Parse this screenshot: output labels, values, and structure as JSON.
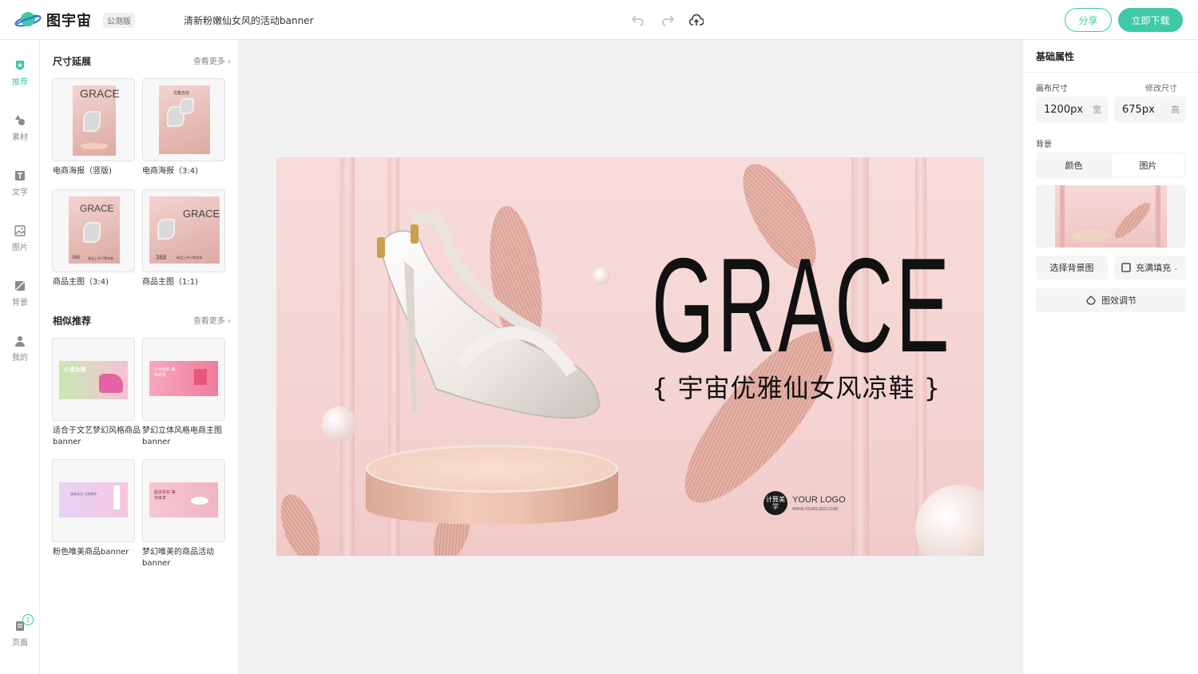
{
  "header": {
    "brand": "图宇宙",
    "beta": "公测版",
    "doc_title": "清新粉嫩仙女风的活动banner",
    "share_label": "分享",
    "download_label": "立即下载",
    "accent": "#3fc9a8"
  },
  "rail": {
    "items": [
      {
        "label": "推荐",
        "icon": "star-badge-icon"
      },
      {
        "label": "素材",
        "icon": "shapes-icon"
      },
      {
        "label": "文字",
        "icon": "text-icon"
      },
      {
        "label": "图片",
        "icon": "image-icon"
      },
      {
        "label": "背景",
        "icon": "background-icon"
      },
      {
        "label": "我的",
        "icon": "user-icon"
      }
    ],
    "pages_label": "页面",
    "pages_count": "1"
  },
  "panel": {
    "size_section": {
      "title": "尺寸延展",
      "more": "查看更多",
      "cards": [
        {
          "caption": "电商海报（竖版)",
          "grace": "GRACE"
        },
        {
          "caption": "电商海报（3:4)",
          "tag": "优雅自信"
        },
        {
          "caption": "商品主图（3:4)",
          "grace": "GRACE",
          "price": "368",
          "promo": "新品上市只等你来"
        },
        {
          "caption": "商品主图（1:1)",
          "grace": "GRACE",
          "price": "368",
          "promo": "新品上市只等你来"
        }
      ]
    },
    "similar_section": {
      "title": "相似推荐",
      "more": "查看更多",
      "cards": [
        {
          "caption": "适合于文艺梦幻风格商品banner",
          "thumb_text": "小宙女鞋"
        },
        {
          "caption": "梦幻立体风格电商主图banner",
          "thumb_text": "少女色彩 趣味彩妆"
        },
        {
          "caption": "粉色唯美商品banner",
          "thumb_text": "清新沐浴 水润修护"
        },
        {
          "caption": "梦幻唯美的商品活动banner",
          "thumb_text": "超多折扣 等你来享"
        }
      ]
    }
  },
  "canvas": {
    "headline": "GRACE",
    "subline": "{ 宇宙优雅仙女风凉鞋 }",
    "logo_mark": "计算美学",
    "logo_text": "YOUR LOGO",
    "logo_url": "WWW.YOURLOGO.COM"
  },
  "props": {
    "title": "基础属性",
    "canvas_size_label": "画布尺寸",
    "resize_link": "修改尺寸",
    "width_value": "1200px",
    "width_unit": "宽",
    "height_value": "675px",
    "height_unit": "高",
    "bg_label": "背景",
    "tab_color": "颜色",
    "tab_image": "图片",
    "select_bg": "选择背景图",
    "fill_mode": "充满填充",
    "adjust": "图效调节"
  }
}
